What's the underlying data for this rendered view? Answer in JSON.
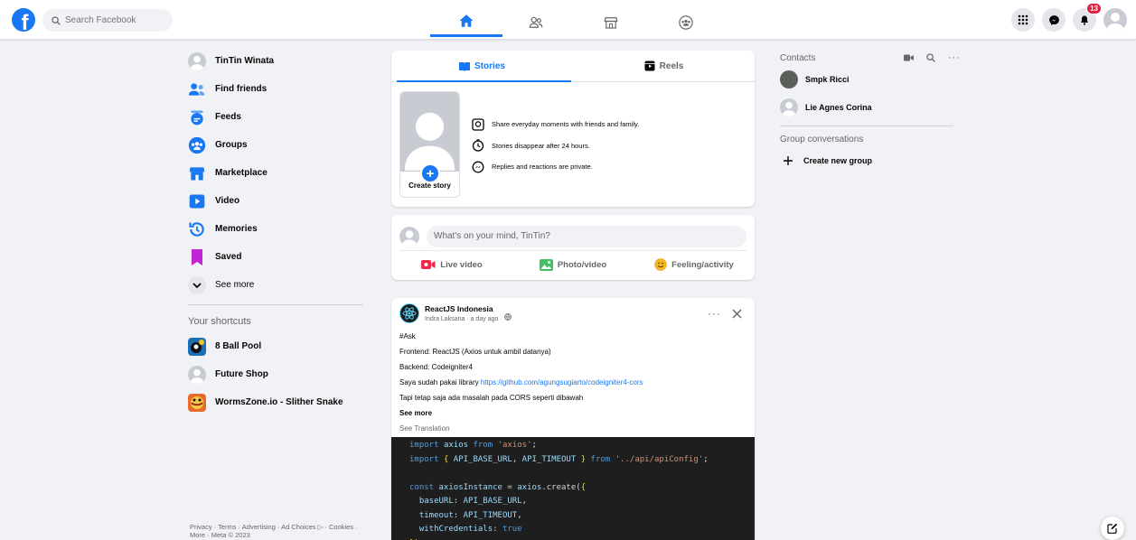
{
  "topbar": {
    "logo_letter": "f",
    "search_placeholder": "Search Facebook",
    "notification_count": "13",
    "nav_tabs": [
      "home-icon",
      "friends-icon",
      "marketplace-icon",
      "groups-icon"
    ]
  },
  "left_sidebar": {
    "items": [
      {
        "label": "TinTin Winata",
        "icon": "profile-avatar"
      },
      {
        "label": "Find friends",
        "icon": "friends-icon"
      },
      {
        "label": "Feeds",
        "icon": "feeds-icon"
      },
      {
        "label": "Groups",
        "icon": "groups-icon"
      },
      {
        "label": "Marketplace",
        "icon": "marketplace-icon"
      },
      {
        "label": "Video",
        "icon": "video-icon"
      },
      {
        "label": "Memories",
        "icon": "memories-icon"
      },
      {
        "label": "Saved",
        "icon": "saved-icon"
      },
      {
        "label": "See more",
        "icon": "chevron-down-icon"
      }
    ],
    "shortcuts_title": "Your shortcuts",
    "shortcuts": [
      {
        "label": "8 Ball Pool"
      },
      {
        "label": "Future Shop"
      },
      {
        "label": "WormsZone.io - Slither Snake"
      }
    ],
    "footer_line1": "Privacy · Terms · Advertising · Ad Choices ▷ · Cookies ·",
    "footer_line2": "More · Meta © 2023"
  },
  "stories": {
    "tab_stories": "Stories",
    "tab_reels": "Reels",
    "create_story": "Create story",
    "info": [
      "Share everyday moments with friends and family.",
      "Stories disappear after 24 hours.",
      "Replies and reactions are private."
    ]
  },
  "composer": {
    "placeholder": "What's on your mind, TinTin?",
    "live_video": "Live video",
    "photo_video": "Photo/video",
    "feeling": "Feeling/activity"
  },
  "post": {
    "group_name": "ReactJS Indonesia",
    "author_meta": "Indra Laksana · a day ago ·",
    "lines": [
      "#Ask",
      "Frontend: ReactJS (Axios untuk ambil datanya)",
      "Backend: Codeigniter4"
    ],
    "library_prefix": "Saya sudah pakai library ",
    "library_link": "https://github.com/agungsugiarto/codeigniter4-cors",
    "line_cors": "Tapi tetap saja ada masalah pada CORS seperti dibawah",
    "see_more": "See more",
    "see_translation": "See Translation"
  },
  "contacts": {
    "title": "Contacts",
    "people": [
      {
        "name": "Smpk Ricci"
      },
      {
        "name": "Lie Agnes Corina"
      }
    ],
    "group_conversations": "Group conversations",
    "create_group": "Create new group"
  }
}
